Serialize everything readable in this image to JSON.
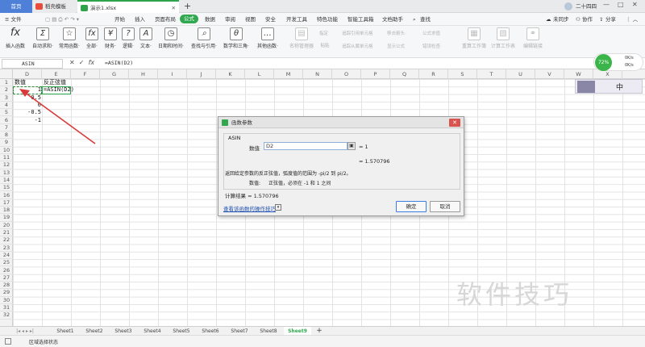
{
  "titlebar": {
    "home": "首页",
    "template": "稻壳模板",
    "doc": "演示1.xlsx",
    "new_tab": "+",
    "user": "二十四四",
    "minimize": "—",
    "maximize": "□",
    "close": "✕"
  },
  "menubar": {
    "file": "≡ 文件",
    "items": [
      "开始",
      "插入",
      "页面布局",
      "公式",
      "数据",
      "审阅",
      "视图",
      "安全",
      "开发工具",
      "特色功能",
      "智能工具箱",
      "文档助手",
      "查找"
    ],
    "sync": "未同步",
    "collab": "协作",
    "share": "分享"
  },
  "ribbon": {
    "buttons": [
      {
        "label": "插入函数",
        "glyph": "fx"
      },
      {
        "label": "自动求和·",
        "glyph": "Σ"
      },
      {
        "label": "常用函数·",
        "glyph": "☆"
      },
      {
        "label": "全部·",
        "glyph": "fx"
      },
      {
        "label": "财务·",
        "glyph": "¥"
      },
      {
        "label": "逻辑·",
        "glyph": "?"
      },
      {
        "label": "文本·",
        "glyph": "A"
      },
      {
        "label": "日期和时间·",
        "glyph": "◷"
      },
      {
        "label": "查找与引用·",
        "glyph": "⌕"
      },
      {
        "label": "数学和三角·",
        "glyph": "θ"
      },
      {
        "label": "其他函数·",
        "glyph": "…"
      }
    ],
    "disabled": [
      {
        "label": "名称管理器",
        "glyph": "▤"
      },
      {
        "label": "粘贴",
        "glyph": "▥"
      },
      {
        "label": "重算工作簿",
        "glyph": "▦"
      },
      {
        "label": "计算工作表",
        "glyph": "▧"
      },
      {
        "label": "编辑链接",
        "glyph": "⚭"
      }
    ],
    "small": [
      "指定",
      "追踪引用单元格",
      "移去箭头·",
      "公式求值",
      "追踪从属单元格",
      "显示公式",
      "错误检查·"
    ]
  },
  "formula": {
    "name": "ASIN",
    "formula": "=ASIN(D2)"
  },
  "columns": [
    "D",
    "E",
    "F",
    "G",
    "H",
    "I",
    "J",
    "K",
    "L",
    "M",
    "N",
    "O",
    "P",
    "Q",
    "R",
    "S",
    "T",
    "U",
    "V",
    "W",
    "X"
  ],
  "rows": [
    "1",
    "2",
    "3",
    "4",
    "5",
    "6",
    "7",
    "8",
    "9",
    "10",
    "11",
    "12",
    "13",
    "14",
    "15",
    "16",
    "17",
    "18",
    "19",
    "20",
    "21",
    "22",
    "23",
    "24",
    "25",
    "26",
    "27",
    "28",
    "29",
    "30",
    "31",
    "32"
  ],
  "cells": {
    "d1": "数值",
    "e1": "反正弦值",
    "d2": "1",
    "e2": "=ASIN(D2)",
    "d3": "0.5",
    "d4": "0",
    "d5": "-0.5",
    "d6": "-1"
  },
  "dialog": {
    "title": "函数参数",
    "func": "ASIN",
    "arg_label": "数值",
    "arg_value": "D2",
    "arg_result": "= 1",
    "result_preview": "= 1.570796",
    "desc": "返回给定参数的反正弦值，弧度值的范围为 -pi/2 到 pi/2。",
    "arg_desc_label": "数值:",
    "arg_desc": "正弦值，必须在 -1 和 1 之间",
    "calc_result": "计算结果 = 1.570796",
    "help_link": "查看该函数的操作技巧",
    "ok": "确定",
    "cancel": "取消"
  },
  "sheets": [
    "Sheet1",
    "Sheet2",
    "Sheet3",
    "Sheet4",
    "Sheet5",
    "Sheet6",
    "Sheet7",
    "Sheet8",
    "Sheet9"
  ],
  "active_sheet": "Sheet9",
  "add_sheet": "+",
  "status": {
    "mode": "区域选择状态"
  },
  "widget": {
    "percent": "72%",
    "up": "0K/s",
    "down": "0K/s",
    "ime": "中"
  },
  "watermark": "软件技巧",
  "colors": {
    "accent": "#30a84f",
    "home_tab": "#4e80d8",
    "close": "#d9534f",
    "arrow": "#d93a3a"
  }
}
